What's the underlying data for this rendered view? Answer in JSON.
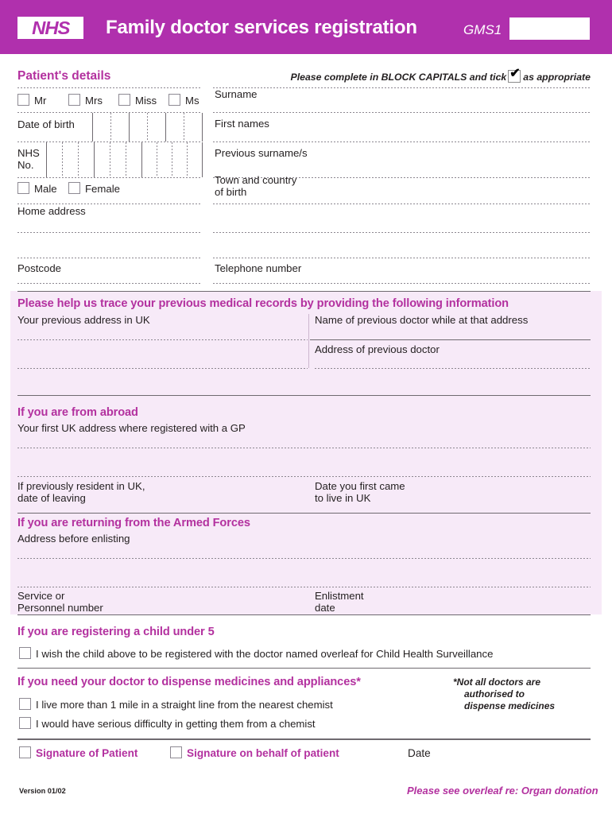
{
  "header": {
    "logo_text": "NHS",
    "title": "Family doctor services registration",
    "form_code": "GMS1",
    "form_code_box_value": ""
  },
  "patient_details": {
    "section_title": "Patient's details",
    "instruction_before": "Please complete in BLOCK CAPITALS and tick",
    "instruction_after": "as appropriate",
    "tick_glyph": "✔",
    "titles": [
      "Mr",
      "Mrs",
      "Miss",
      "Ms"
    ],
    "date_of_birth_label": "Date of birth",
    "nhs_no_label_line1": "NHS",
    "nhs_no_label_line2": "No.",
    "genders": [
      "Male",
      "Female"
    ],
    "home_address_label": "Home address",
    "postcode_label": "Postcode",
    "surname_label": "Surname",
    "first_names_label": "First names",
    "previous_surnames_label": "Previous surname/s",
    "town_country_label_line1": "Town and country",
    "town_country_label_line2": "of birth",
    "telephone_label": "Telephone number"
  },
  "trace_records": {
    "heading": "Please help us trace your previous medical records by providing the following information",
    "previous_address_label": "Your previous address in UK",
    "previous_doctor_name_label": "Name of previous doctor while at that address",
    "previous_doctor_address_label": "Address of previous doctor"
  },
  "from_abroad": {
    "heading": "If you are from abroad",
    "first_uk_address_label": "Your first UK address where registered with a GP",
    "date_of_leaving_label_line1": "If previously resident in UK,",
    "date_of_leaving_label_line2": "date of leaving",
    "date_came_label_line1": "Date you first came",
    "date_came_label_line2": "to live in UK"
  },
  "armed_forces": {
    "heading": "If you are returning from the Armed Forces",
    "address_before_enlisting_label": "Address before enlisting",
    "service_number_label_line1": "Service or",
    "service_number_label_line2": "Personnel number",
    "enlistment_date_label_line1": "Enlistment",
    "enlistment_date_label_line2": "date"
  },
  "child_under_5": {
    "heading": "If you are registering a child under 5",
    "checkbox_label": "I wish the child above to be registered with the doctor named overleaf for Child Health Surveillance"
  },
  "dispensing": {
    "heading": "If you need your doctor to dispense medicines and appliances*",
    "note_line1": "*Not all doctors are",
    "note_line2": "authorised to",
    "note_line3": "dispense medicines",
    "option1": "I live more than 1 mile in a straight line from the nearest chemist",
    "option2": "I would have serious difficulty in getting them from a chemist"
  },
  "signatures": {
    "signature_of_patient": "Signature of Patient",
    "signature_on_behalf": "Signature on behalf of patient",
    "date_label": "Date"
  },
  "footer": {
    "version": "Version 01/02",
    "overleaf_note": "Please see overleaf re: Organ donation"
  },
  "colors": {
    "header_purple": "#b030ad",
    "heading_purple": "#b3319f",
    "section_pink": "#f7eaf8",
    "rule_grey": "#6f6a70"
  }
}
